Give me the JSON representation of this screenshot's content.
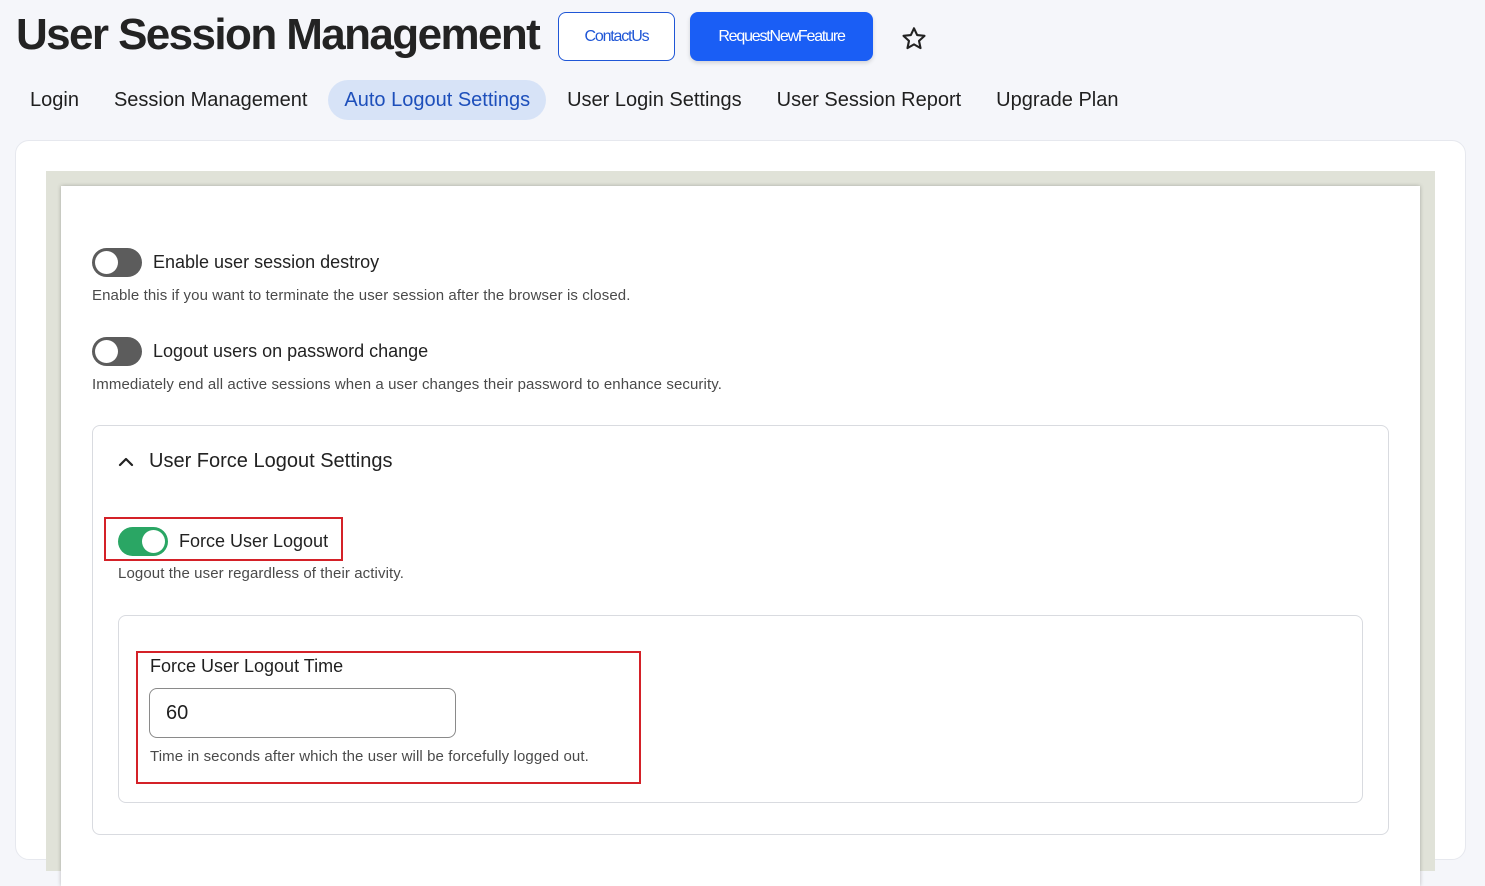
{
  "header": {
    "title": "User Session Management",
    "contact_label": "ContactUs",
    "request_label": "RequestNewFeature",
    "favorite_icon": "star-icon"
  },
  "tabs": [
    {
      "label": "Login",
      "active": false
    },
    {
      "label": "Session Management",
      "active": false
    },
    {
      "label": "Auto Logout Settings",
      "active": true
    },
    {
      "label": "User Login Settings",
      "active": false
    },
    {
      "label": "User Session Report",
      "active": false
    },
    {
      "label": "Upgrade Plan",
      "active": false
    }
  ],
  "settings": {
    "session_destroy": {
      "label": "Enable user session destroy",
      "description": "Enable this if you want to terminate the user session after the browser is closed.",
      "enabled": false
    },
    "password_change": {
      "label": "Logout users on password change",
      "description": "Immediately end all active sessions when a user changes their password to enhance security.",
      "enabled": false
    }
  },
  "force_logout": {
    "section_title": "User Force Logout Settings",
    "toggle_label": "Force User Logout",
    "toggle_description": "Logout the user regardless of their activity.",
    "enabled": true,
    "time_label": "Force User Logout Time",
    "time_value": "60",
    "time_description": "Time in seconds after which the user will be forcefully logged out."
  },
  "colors": {
    "primary": "#1a5ef5",
    "toggle_on": "#2aa664",
    "toggle_off": "#5c5c5c",
    "highlight": "#d42128",
    "active_tab_bg": "#d7e3f7"
  }
}
